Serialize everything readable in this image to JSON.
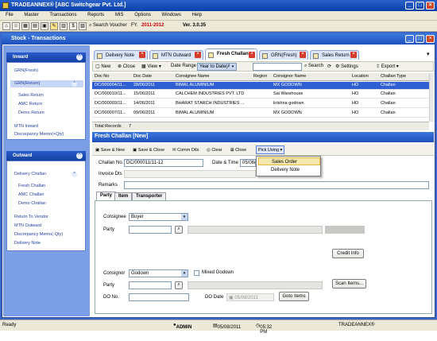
{
  "window": {
    "title": "TRADEANNEX® [ABC Switchgear Pvt. Ltd.]"
  },
  "menu": [
    "File",
    "Master",
    "Transactions",
    "Reports",
    "MIS",
    "Options",
    "Windows",
    "Help"
  ],
  "toolbar": {
    "search_voucher": "Search Voucher",
    "fy_label": "FY.",
    "fy_value": "2011-2012",
    "version": "Ver. 3.0.35"
  },
  "child": {
    "title": "Stock - Transactions"
  },
  "sidebar": {
    "inward": {
      "title": "Inward",
      "items": [
        "GRN(Fresh)",
        "GRN(Return)",
        "Sales Return",
        "AMC Return",
        "Demo Return",
        "MTN Inward",
        "Discrepancy Memo(+Qty)"
      ]
    },
    "outward": {
      "title": "Outward",
      "items": [
        "Delivery Challan",
        "Fresh Challan",
        "AMC Challan",
        "Demo Challan",
        "Return To Vendor",
        "MTN Outward",
        "Discrepancy Memo(-Qty)",
        "Delivery Note"
      ]
    }
  },
  "tabs": [
    "Delivery Note",
    "MTN Outward",
    "Fresh Challan",
    "GRN(Fresh)",
    "Sales Return"
  ],
  "grid_toolbar": {
    "new": "New",
    "close": "Close",
    "view": "View",
    "date_range": "Date Range",
    "range_value": "Year to Date(All)",
    "search": "Search",
    "settings": "Settings",
    "export": "Export"
  },
  "grid": {
    "columns": [
      "Doc No",
      "Doc Date",
      "Consignee Name",
      "Region",
      "Consignor Name",
      "Location",
      "Challan Type"
    ],
    "rows": [
      [
        "DC/000004/11...",
        "28/06/2011",
        "BIMAL ALUMINIUM",
        "",
        "MX GODOWN",
        "HO",
        "Challan"
      ],
      [
        "DC/000010/11...",
        "15/06/2011",
        "CALCHEM INDUSTRIES PVT. LTD",
        "",
        "Sai Warehouse",
        "HO",
        "Challan"
      ],
      [
        "DC/000003/11...",
        "14/06/2011",
        "BHARAT STARCH INDUSTRIES ...",
        "",
        "krishna godown",
        "HO",
        "Challan"
      ],
      [
        "DC/000007/11...",
        "09/06/2011",
        "BIMAL ALUMINIUM",
        "",
        "MX GODOWN",
        "HO",
        "Challan"
      ]
    ],
    "total_label": "Total Records",
    "total_value": "7"
  },
  "form": {
    "title": "Fresh Challan [New]",
    "buttons": {
      "save_new": "Save & New",
      "save_close": "Save & Close",
      "comm_dtls": "Comm Dtls",
      "clear": "Clear",
      "close": "Close",
      "pick_using": "Pick Using"
    },
    "dropdown": [
      "Sales Order",
      "Delivery Note"
    ],
    "challan_no_label": "Challan No.",
    "challan_no": "DC/000011/11-12",
    "date_time_label": "Date & Time",
    "date_value": "05/08/",
    "invoice_dts_label": "Invoice Dts",
    "remarks_label": "Remarks",
    "sub_tabs": [
      "Party",
      "Item",
      "Transporter"
    ],
    "consignee_label": "Consignee",
    "consignee_value": "Buyer",
    "party_label": "Party",
    "credit_info": "Credit Info",
    "consignor_label": "Consignor",
    "consignor_value": "Godown",
    "mixed_godown": "Mixed Godown",
    "party2_label": "Party",
    "scan_items": "Scan Items...",
    "do_no_label": "DO No.",
    "do_date_label": "DO Date",
    "do_date_value": "05/08/2011",
    "goto_items": "Goto Items"
  },
  "status": {
    "ready": "Ready",
    "user": "ADMIN",
    "date": "05/08/2011",
    "time": "05:32 PM",
    "app": "TRADEANNEX®"
  }
}
